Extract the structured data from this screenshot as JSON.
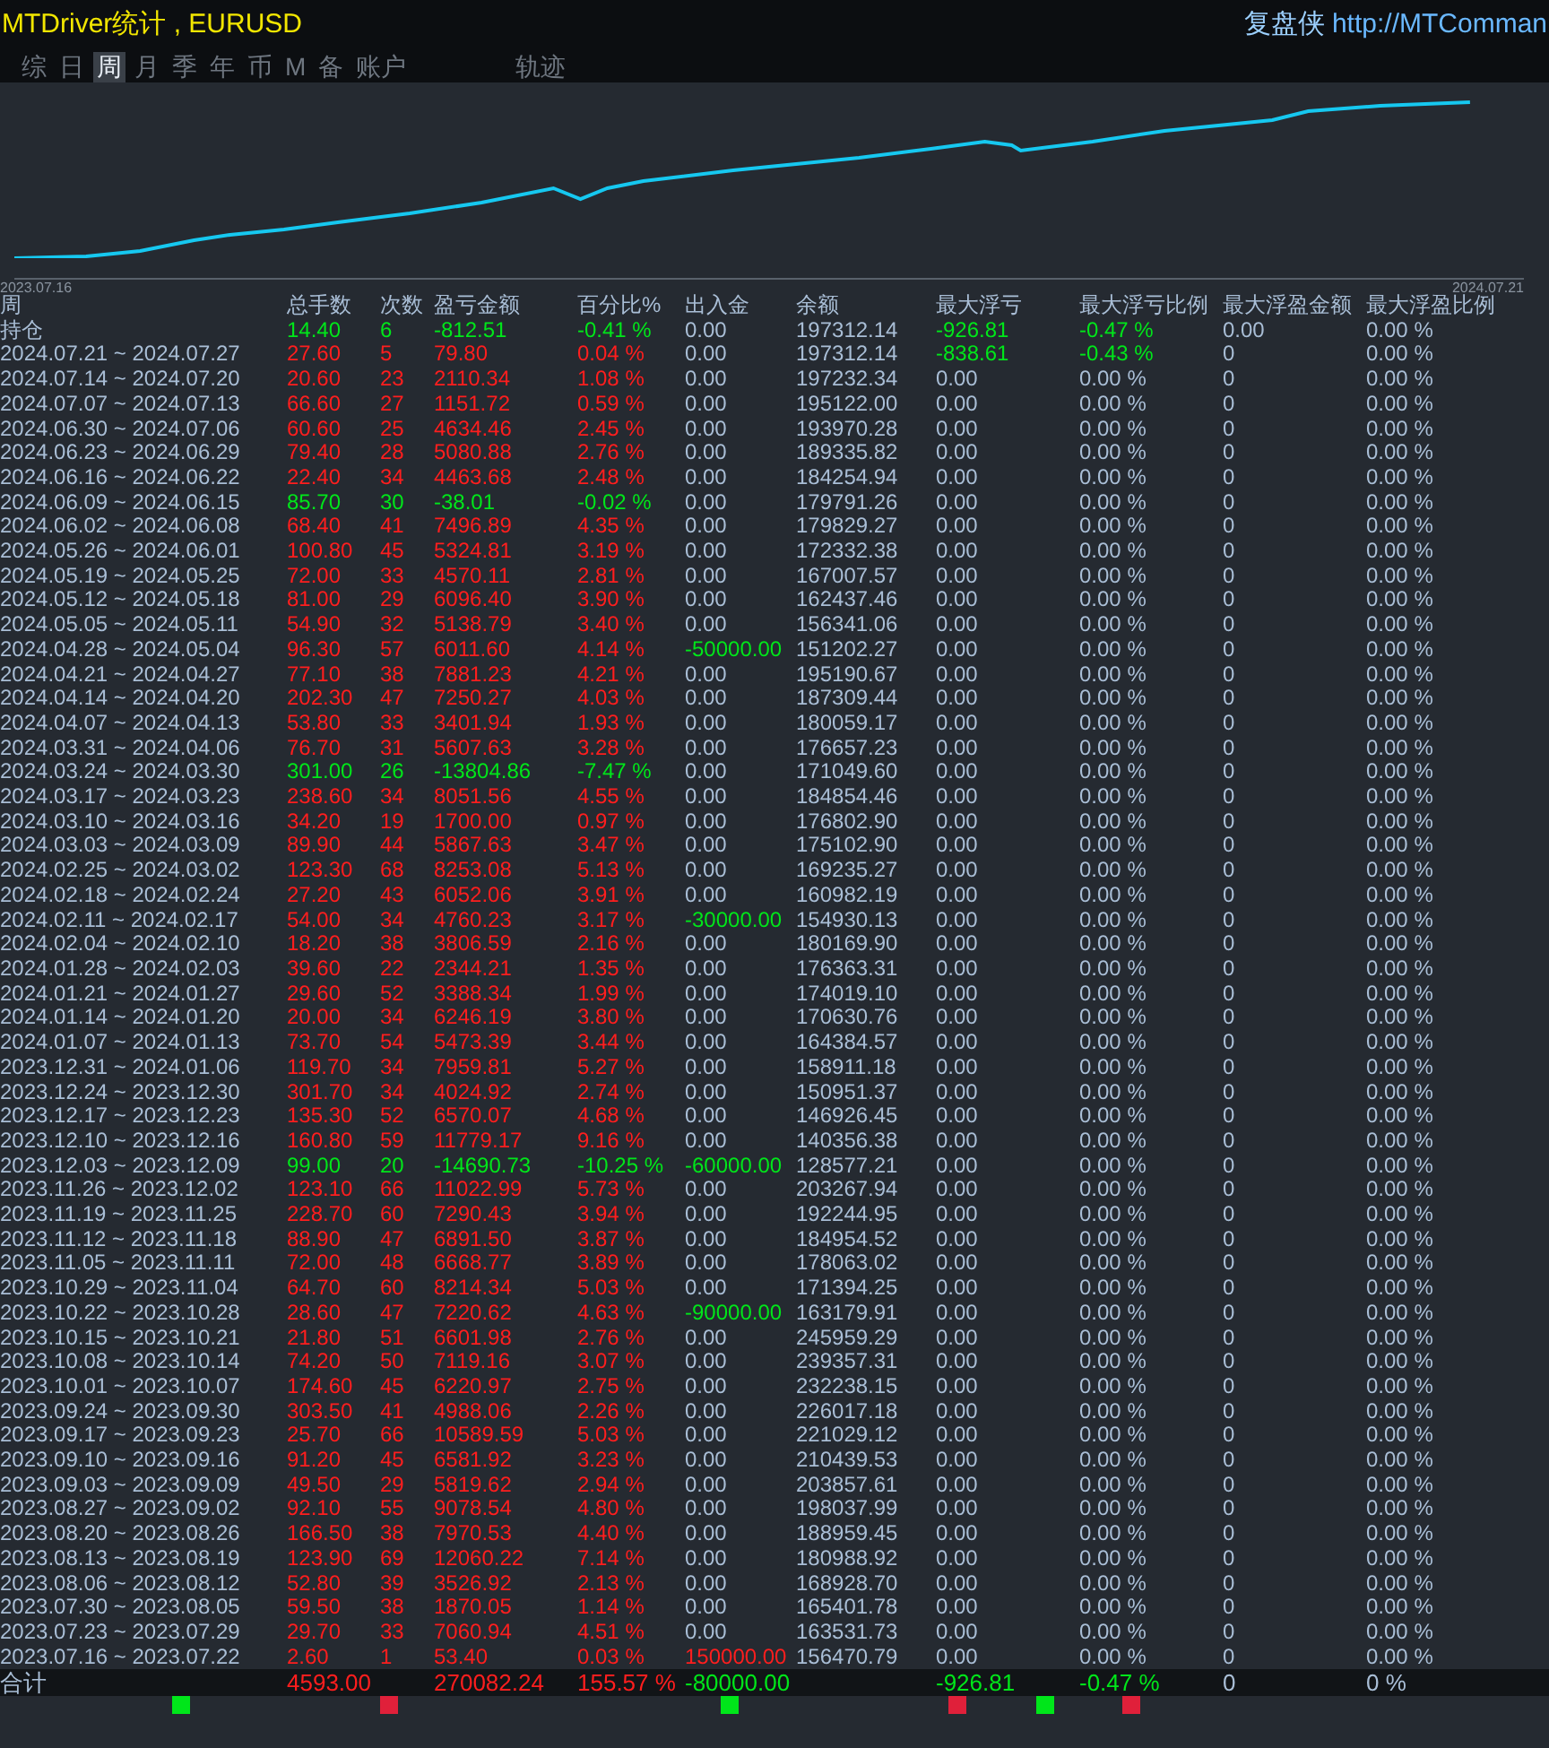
{
  "title": "MTDriver统计 , EURUSD",
  "brand": "复盘侠",
  "url": "http://MTComman",
  "tabs": [
    {
      "label": "综",
      "selected": false
    },
    {
      "label": "日",
      "selected": false
    },
    {
      "label": "周",
      "selected": true
    },
    {
      "label": "月",
      "selected": false
    },
    {
      "label": "季",
      "selected": false
    },
    {
      "label": "年",
      "selected": false
    },
    {
      "label": "币",
      "selected": false
    },
    {
      "label": "M",
      "selected": false
    },
    {
      "label": "备",
      "selected": false
    },
    {
      "label": "账户",
      "selected": false
    },
    {
      "label": "轨迹",
      "selected": false
    }
  ],
  "chart": {
    "start": "2023.07.16",
    "end": "2024.07.21"
  },
  "columns": [
    "周",
    "总手数",
    "次数",
    "盈亏金额",
    "百分比%",
    "出入金",
    "余额",
    "最大浮亏",
    "最大浮亏比例",
    "最大浮盈金额",
    "最大浮盈比例"
  ],
  "rows": [
    {
      "period": "持仓",
      "lots": "14.40",
      "trades": "6",
      "pnl": "-812.51",
      "pct": "-0.41 %",
      "flow_amount": "0.00",
      "balance": "197312.14",
      "max_loss": "-926.81",
      "max_loss_pct": "-0.47 %",
      "max_gain": "0.00",
      "max_gain_pct": "0.00 %",
      "profit": false,
      "inflow": false,
      "outflow": false,
      "loss_open": true
    },
    {
      "period": "2024.07.21 ~ 2024.07.27",
      "lots": "27.60",
      "trades": "5",
      "pnl": "79.80",
      "pct": "0.04 %",
      "flow_amount": "0.00",
      "balance": "197312.14",
      "max_loss": "-838.61",
      "max_loss_pct": "-0.43 %",
      "max_gain": "0",
      "max_gain_pct": "0.00 %",
      "profit": true,
      "inflow": false,
      "outflow": false,
      "loss_open": true
    },
    {
      "period": "2024.07.14 ~ 2024.07.20",
      "lots": "20.60",
      "trades": "23",
      "pnl": "2110.34",
      "pct": "1.08 %",
      "flow_amount": "0.00",
      "balance": "197232.34",
      "max_loss": "0.00",
      "max_loss_pct": "0.00 %",
      "max_gain": "0",
      "max_gain_pct": "0.00 %",
      "profit": true,
      "inflow": false,
      "outflow": false,
      "loss_open": false
    },
    {
      "period": "2024.07.07 ~ 2024.07.13",
      "lots": "66.60",
      "trades": "27",
      "pnl": "1151.72",
      "pct": "0.59 %",
      "flow_amount": "0.00",
      "balance": "195122.00",
      "max_loss": "0.00",
      "max_loss_pct": "0.00 %",
      "max_gain": "0",
      "max_gain_pct": "0.00 %",
      "profit": true,
      "inflow": false,
      "outflow": false,
      "loss_open": false
    },
    {
      "period": "2024.06.30 ~ 2024.07.06",
      "lots": "60.60",
      "trades": "25",
      "pnl": "4634.46",
      "pct": "2.45 %",
      "flow_amount": "0.00",
      "balance": "193970.28",
      "max_loss": "0.00",
      "max_loss_pct": "0.00 %",
      "max_gain": "0",
      "max_gain_pct": "0.00 %",
      "profit": true,
      "inflow": false,
      "outflow": false,
      "loss_open": false
    },
    {
      "period": "2024.06.23 ~ 2024.06.29",
      "lots": "79.40",
      "trades": "28",
      "pnl": "5080.88",
      "pct": "2.76 %",
      "flow_amount": "0.00",
      "balance": "189335.82",
      "max_loss": "0.00",
      "max_loss_pct": "0.00 %",
      "max_gain": "0",
      "max_gain_pct": "0.00 %",
      "profit": true,
      "inflow": false,
      "outflow": false,
      "loss_open": false
    },
    {
      "period": "2024.06.16 ~ 2024.06.22",
      "lots": "22.40",
      "trades": "34",
      "pnl": "4463.68",
      "pct": "2.48 %",
      "flow_amount": "0.00",
      "balance": "184254.94",
      "max_loss": "0.00",
      "max_loss_pct": "0.00 %",
      "max_gain": "0",
      "max_gain_pct": "0.00 %",
      "profit": true,
      "inflow": false,
      "outflow": false,
      "loss_open": false
    },
    {
      "period": "2024.06.09 ~ 2024.06.15",
      "lots": "85.70",
      "trades": "30",
      "pnl": "-38.01",
      "pct": "-0.02 %",
      "flow_amount": "0.00",
      "balance": "179791.26",
      "max_loss": "0.00",
      "max_loss_pct": "0.00 %",
      "max_gain": "0",
      "max_gain_pct": "0.00 %",
      "profit": false,
      "inflow": false,
      "outflow": false,
      "loss_open": false
    },
    {
      "period": "2024.06.02 ~ 2024.06.08",
      "lots": "68.40",
      "trades": "41",
      "pnl": "7496.89",
      "pct": "4.35 %",
      "flow_amount": "0.00",
      "balance": "179829.27",
      "max_loss": "0.00",
      "max_loss_pct": "0.00 %",
      "max_gain": "0",
      "max_gain_pct": "0.00 %",
      "profit": true,
      "inflow": false,
      "outflow": false,
      "loss_open": false
    },
    {
      "period": "2024.05.26 ~ 2024.06.01",
      "lots": "100.80",
      "trades": "45",
      "pnl": "5324.81",
      "pct": "3.19 %",
      "flow_amount": "0.00",
      "balance": "172332.38",
      "max_loss": "0.00",
      "max_loss_pct": "0.00 %",
      "max_gain": "0",
      "max_gain_pct": "0.00 %",
      "profit": true,
      "inflow": false,
      "outflow": false,
      "loss_open": false
    },
    {
      "period": "2024.05.19 ~ 2024.05.25",
      "lots": "72.00",
      "trades": "33",
      "pnl": "4570.11",
      "pct": "2.81 %",
      "flow_amount": "0.00",
      "balance": "167007.57",
      "max_loss": "0.00",
      "max_loss_pct": "0.00 %",
      "max_gain": "0",
      "max_gain_pct": "0.00 %",
      "profit": true,
      "inflow": false,
      "outflow": false,
      "loss_open": false
    },
    {
      "period": "2024.05.12 ~ 2024.05.18",
      "lots": "81.00",
      "trades": "29",
      "pnl": "6096.40",
      "pct": "3.90 %",
      "flow_amount": "0.00",
      "balance": "162437.46",
      "max_loss": "0.00",
      "max_loss_pct": "0.00 %",
      "max_gain": "0",
      "max_gain_pct": "0.00 %",
      "profit": true,
      "inflow": false,
      "outflow": false,
      "loss_open": false
    },
    {
      "period": "2024.05.05 ~ 2024.05.11",
      "lots": "54.90",
      "trades": "32",
      "pnl": "5138.79",
      "pct": "3.40 %",
      "flow_amount": "0.00",
      "balance": "156341.06",
      "max_loss": "0.00",
      "max_loss_pct": "0.00 %",
      "max_gain": "0",
      "max_gain_pct": "0.00 %",
      "profit": true,
      "inflow": false,
      "outflow": false,
      "loss_open": false
    },
    {
      "period": "2024.04.28 ~ 2024.05.04",
      "lots": "96.30",
      "trades": "57",
      "pnl": "6011.60",
      "pct": "4.14 %",
      "flow_amount": "-50000.00",
      "balance": "151202.27",
      "max_loss": "0.00",
      "max_loss_pct": "0.00 %",
      "max_gain": "0",
      "max_gain_pct": "0.00 %",
      "profit": true,
      "inflow": false,
      "outflow": true,
      "loss_open": false
    },
    {
      "period": "2024.04.21 ~ 2024.04.27",
      "lots": "77.10",
      "trades": "38",
      "pnl": "7881.23",
      "pct": "4.21 %",
      "flow_amount": "0.00",
      "balance": "195190.67",
      "max_loss": "0.00",
      "max_loss_pct": "0.00 %",
      "max_gain": "0",
      "max_gain_pct": "0.00 %",
      "profit": true,
      "inflow": false,
      "outflow": false,
      "loss_open": false
    },
    {
      "period": "2024.04.14 ~ 2024.04.20",
      "lots": "202.30",
      "trades": "47",
      "pnl": "7250.27",
      "pct": "4.03 %",
      "flow_amount": "0.00",
      "balance": "187309.44",
      "max_loss": "0.00",
      "max_loss_pct": "0.00 %",
      "max_gain": "0",
      "max_gain_pct": "0.00 %",
      "profit": true,
      "inflow": false,
      "outflow": false,
      "loss_open": false
    },
    {
      "period": "2024.04.07 ~ 2024.04.13",
      "lots": "53.80",
      "trades": "33",
      "pnl": "3401.94",
      "pct": "1.93 %",
      "flow_amount": "0.00",
      "balance": "180059.17",
      "max_loss": "0.00",
      "max_loss_pct": "0.00 %",
      "max_gain": "0",
      "max_gain_pct": "0.00 %",
      "profit": true,
      "inflow": false,
      "outflow": false,
      "loss_open": false
    },
    {
      "period": "2024.03.31 ~ 2024.04.06",
      "lots": "76.70",
      "trades": "31",
      "pnl": "5607.63",
      "pct": "3.28 %",
      "flow_amount": "0.00",
      "balance": "176657.23",
      "max_loss": "0.00",
      "max_loss_pct": "0.00 %",
      "max_gain": "0",
      "max_gain_pct": "0.00 %",
      "profit": true,
      "inflow": false,
      "outflow": false,
      "loss_open": false
    },
    {
      "period": "2024.03.24 ~ 2024.03.30",
      "lots": "301.00",
      "trades": "26",
      "pnl": "-13804.86",
      "pct": "-7.47 %",
      "flow_amount": "0.00",
      "balance": "171049.60",
      "max_loss": "0.00",
      "max_loss_pct": "0.00 %",
      "max_gain": "0",
      "max_gain_pct": "0.00 %",
      "profit": false,
      "inflow": false,
      "outflow": false,
      "loss_open": false
    },
    {
      "period": "2024.03.17 ~ 2024.03.23",
      "lots": "238.60",
      "trades": "34",
      "pnl": "8051.56",
      "pct": "4.55 %",
      "flow_amount": "0.00",
      "balance": "184854.46",
      "max_loss": "0.00",
      "max_loss_pct": "0.00 %",
      "max_gain": "0",
      "max_gain_pct": "0.00 %",
      "profit": true,
      "inflow": false,
      "outflow": false,
      "loss_open": false
    },
    {
      "period": "2024.03.10 ~ 2024.03.16",
      "lots": "34.20",
      "trades": "19",
      "pnl": "1700.00",
      "pct": "0.97 %",
      "flow_amount": "0.00",
      "balance": "176802.90",
      "max_loss": "0.00",
      "max_loss_pct": "0.00 %",
      "max_gain": "0",
      "max_gain_pct": "0.00 %",
      "profit": true,
      "inflow": false,
      "outflow": false,
      "loss_open": false
    },
    {
      "period": "2024.03.03 ~ 2024.03.09",
      "lots": "89.90",
      "trades": "44",
      "pnl": "5867.63",
      "pct": "3.47 %",
      "flow_amount": "0.00",
      "balance": "175102.90",
      "max_loss": "0.00",
      "max_loss_pct": "0.00 %",
      "max_gain": "0",
      "max_gain_pct": "0.00 %",
      "profit": true,
      "inflow": false,
      "outflow": false,
      "loss_open": false
    },
    {
      "period": "2024.02.25 ~ 2024.03.02",
      "lots": "123.30",
      "trades": "68",
      "pnl": "8253.08",
      "pct": "5.13 %",
      "flow_amount": "0.00",
      "balance": "169235.27",
      "max_loss": "0.00",
      "max_loss_pct": "0.00 %",
      "max_gain": "0",
      "max_gain_pct": "0.00 %",
      "profit": true,
      "inflow": false,
      "outflow": false,
      "loss_open": false
    },
    {
      "period": "2024.02.18 ~ 2024.02.24",
      "lots": "27.20",
      "trades": "43",
      "pnl": "6052.06",
      "pct": "3.91 %",
      "flow_amount": "0.00",
      "balance": "160982.19",
      "max_loss": "0.00",
      "max_loss_pct": "0.00 %",
      "max_gain": "0",
      "max_gain_pct": "0.00 %",
      "profit": true,
      "inflow": false,
      "outflow": false,
      "loss_open": false
    },
    {
      "period": "2024.02.11 ~ 2024.02.17",
      "lots": "54.00",
      "trades": "34",
      "pnl": "4760.23",
      "pct": "3.17 %",
      "flow_amount": "-30000.00",
      "balance": "154930.13",
      "max_loss": "0.00",
      "max_loss_pct": "0.00 %",
      "max_gain": "0",
      "max_gain_pct": "0.00 %",
      "profit": true,
      "inflow": false,
      "outflow": true,
      "loss_open": false
    },
    {
      "period": "2024.02.04 ~ 2024.02.10",
      "lots": "18.20",
      "trades": "38",
      "pnl": "3806.59",
      "pct": "2.16 %",
      "flow_amount": "0.00",
      "balance": "180169.90",
      "max_loss": "0.00",
      "max_loss_pct": "0.00 %",
      "max_gain": "0",
      "max_gain_pct": "0.00 %",
      "profit": true,
      "inflow": false,
      "outflow": false,
      "loss_open": false
    },
    {
      "period": "2024.01.28 ~ 2024.02.03",
      "lots": "39.60",
      "trades": "22",
      "pnl": "2344.21",
      "pct": "1.35 %",
      "flow_amount": "0.00",
      "balance": "176363.31",
      "max_loss": "0.00",
      "max_loss_pct": "0.00 %",
      "max_gain": "0",
      "max_gain_pct": "0.00 %",
      "profit": true,
      "inflow": false,
      "outflow": false,
      "loss_open": false
    },
    {
      "period": "2024.01.21 ~ 2024.01.27",
      "lots": "29.60",
      "trades": "52",
      "pnl": "3388.34",
      "pct": "1.99 %",
      "flow_amount": "0.00",
      "balance": "174019.10",
      "max_loss": "0.00",
      "max_loss_pct": "0.00 %",
      "max_gain": "0",
      "max_gain_pct": "0.00 %",
      "profit": true,
      "inflow": false,
      "outflow": false,
      "loss_open": false
    },
    {
      "period": "2024.01.14 ~ 2024.01.20",
      "lots": "20.00",
      "trades": "34",
      "pnl": "6246.19",
      "pct": "3.80 %",
      "flow_amount": "0.00",
      "balance": "170630.76",
      "max_loss": "0.00",
      "max_loss_pct": "0.00 %",
      "max_gain": "0",
      "max_gain_pct": "0.00 %",
      "profit": true,
      "inflow": false,
      "outflow": false,
      "loss_open": false
    },
    {
      "period": "2024.01.07 ~ 2024.01.13",
      "lots": "73.70",
      "trades": "54",
      "pnl": "5473.39",
      "pct": "3.44 %",
      "flow_amount": "0.00",
      "balance": "164384.57",
      "max_loss": "0.00",
      "max_loss_pct": "0.00 %",
      "max_gain": "0",
      "max_gain_pct": "0.00 %",
      "profit": true,
      "inflow": false,
      "outflow": false,
      "loss_open": false
    },
    {
      "period": "2023.12.31 ~ 2024.01.06",
      "lots": "119.70",
      "trades": "34",
      "pnl": "7959.81",
      "pct": "5.27 %",
      "flow_amount": "0.00",
      "balance": "158911.18",
      "max_loss": "0.00",
      "max_loss_pct": "0.00 %",
      "max_gain": "0",
      "max_gain_pct": "0.00 %",
      "profit": true,
      "inflow": false,
      "outflow": false,
      "loss_open": false
    },
    {
      "period": "2023.12.24 ~ 2023.12.30",
      "lots": "301.70",
      "trades": "34",
      "pnl": "4024.92",
      "pct": "2.74 %",
      "flow_amount": "0.00",
      "balance": "150951.37",
      "max_loss": "0.00",
      "max_loss_pct": "0.00 %",
      "max_gain": "0",
      "max_gain_pct": "0.00 %",
      "profit": true,
      "inflow": false,
      "outflow": false,
      "loss_open": false
    },
    {
      "period": "2023.12.17 ~ 2023.12.23",
      "lots": "135.30",
      "trades": "52",
      "pnl": "6570.07",
      "pct": "4.68 %",
      "flow_amount": "0.00",
      "balance": "146926.45",
      "max_loss": "0.00",
      "max_loss_pct": "0.00 %",
      "max_gain": "0",
      "max_gain_pct": "0.00 %",
      "profit": true,
      "inflow": false,
      "outflow": false,
      "loss_open": false
    },
    {
      "period": "2023.12.10 ~ 2023.12.16",
      "lots": "160.80",
      "trades": "59",
      "pnl": "11779.17",
      "pct": "9.16 %",
      "flow_amount": "0.00",
      "balance": "140356.38",
      "max_loss": "0.00",
      "max_loss_pct": "0.00 %",
      "max_gain": "0",
      "max_gain_pct": "0.00 %",
      "profit": true,
      "inflow": false,
      "outflow": false,
      "loss_open": false
    },
    {
      "period": "2023.12.03 ~ 2023.12.09",
      "lots": "99.00",
      "trades": "20",
      "pnl": "-14690.73",
      "pct": "-10.25 %",
      "flow_amount": "-60000.00",
      "balance": "128577.21",
      "max_loss": "0.00",
      "max_loss_pct": "0.00 %",
      "max_gain": "0",
      "max_gain_pct": "0.00 %",
      "profit": false,
      "inflow": false,
      "outflow": true,
      "loss_open": false
    },
    {
      "period": "2023.11.26 ~ 2023.12.02",
      "lots": "123.10",
      "trades": "66",
      "pnl": "11022.99",
      "pct": "5.73 %",
      "flow_amount": "0.00",
      "balance": "203267.94",
      "max_loss": "0.00",
      "max_loss_pct": "0.00 %",
      "max_gain": "0",
      "max_gain_pct": "0.00 %",
      "profit": true,
      "inflow": false,
      "outflow": false,
      "loss_open": false
    },
    {
      "period": "2023.11.19 ~ 2023.11.25",
      "lots": "228.70",
      "trades": "60",
      "pnl": "7290.43",
      "pct": "3.94 %",
      "flow_amount": "0.00",
      "balance": "192244.95",
      "max_loss": "0.00",
      "max_loss_pct": "0.00 %",
      "max_gain": "0",
      "max_gain_pct": "0.00 %",
      "profit": true,
      "inflow": false,
      "outflow": false,
      "loss_open": false
    },
    {
      "period": "2023.11.12 ~ 2023.11.18",
      "lots": "88.90",
      "trades": "47",
      "pnl": "6891.50",
      "pct": "3.87 %",
      "flow_amount": "0.00",
      "balance": "184954.52",
      "max_loss": "0.00",
      "max_loss_pct": "0.00 %",
      "max_gain": "0",
      "max_gain_pct": "0.00 %",
      "profit": true,
      "inflow": false,
      "outflow": false,
      "loss_open": false
    },
    {
      "period": "2023.11.05 ~ 2023.11.11",
      "lots": "72.00",
      "trades": "48",
      "pnl": "6668.77",
      "pct": "3.89 %",
      "flow_amount": "0.00",
      "balance": "178063.02",
      "max_loss": "0.00",
      "max_loss_pct": "0.00 %",
      "max_gain": "0",
      "max_gain_pct": "0.00 %",
      "profit": true,
      "inflow": false,
      "outflow": false,
      "loss_open": false
    },
    {
      "period": "2023.10.29 ~ 2023.11.04",
      "lots": "64.70",
      "trades": "60",
      "pnl": "8214.34",
      "pct": "5.03 %",
      "flow_amount": "0.00",
      "balance": "171394.25",
      "max_loss": "0.00",
      "max_loss_pct": "0.00 %",
      "max_gain": "0",
      "max_gain_pct": "0.00 %",
      "profit": true,
      "inflow": false,
      "outflow": false,
      "loss_open": false
    },
    {
      "period": "2023.10.22 ~ 2023.10.28",
      "lots": "28.60",
      "trades": "47",
      "pnl": "7220.62",
      "pct": "4.63 %",
      "flow_amount": "-90000.00",
      "balance": "163179.91",
      "max_loss": "0.00",
      "max_loss_pct": "0.00 %",
      "max_gain": "0",
      "max_gain_pct": "0.00 %",
      "profit": true,
      "inflow": false,
      "outflow": true,
      "loss_open": false
    },
    {
      "period": "2023.10.15 ~ 2023.10.21",
      "lots": "21.80",
      "trades": "51",
      "pnl": "6601.98",
      "pct": "2.76 %",
      "flow_amount": "0.00",
      "balance": "245959.29",
      "max_loss": "0.00",
      "max_loss_pct": "0.00 %",
      "max_gain": "0",
      "max_gain_pct": "0.00 %",
      "profit": true,
      "inflow": false,
      "outflow": false,
      "loss_open": false
    },
    {
      "period": "2023.10.08 ~ 2023.10.14",
      "lots": "74.20",
      "trades": "50",
      "pnl": "7119.16",
      "pct": "3.07 %",
      "flow_amount": "0.00",
      "balance": "239357.31",
      "max_loss": "0.00",
      "max_loss_pct": "0.00 %",
      "max_gain": "0",
      "max_gain_pct": "0.00 %",
      "profit": true,
      "inflow": false,
      "outflow": false,
      "loss_open": false
    },
    {
      "period": "2023.10.01 ~ 2023.10.07",
      "lots": "174.60",
      "trades": "45",
      "pnl": "6220.97",
      "pct": "2.75 %",
      "flow_amount": "0.00",
      "balance": "232238.15",
      "max_loss": "0.00",
      "max_loss_pct": "0.00 %",
      "max_gain": "0",
      "max_gain_pct": "0.00 %",
      "profit": true,
      "inflow": false,
      "outflow": false,
      "loss_open": false
    },
    {
      "period": "2023.09.24 ~ 2023.09.30",
      "lots": "303.50",
      "trades": "41",
      "pnl": "4988.06",
      "pct": "2.26 %",
      "flow_amount": "0.00",
      "balance": "226017.18",
      "max_loss": "0.00",
      "max_loss_pct": "0.00 %",
      "max_gain": "0",
      "max_gain_pct": "0.00 %",
      "profit": true,
      "inflow": false,
      "outflow": false,
      "loss_open": false
    },
    {
      "period": "2023.09.17 ~ 2023.09.23",
      "lots": "25.70",
      "trades": "66",
      "pnl": "10589.59",
      "pct": "5.03 %",
      "flow_amount": "0.00",
      "balance": "221029.12",
      "max_loss": "0.00",
      "max_loss_pct": "0.00 %",
      "max_gain": "0",
      "max_gain_pct": "0.00 %",
      "profit": true,
      "inflow": false,
      "outflow": false,
      "loss_open": false
    },
    {
      "period": "2023.09.10 ~ 2023.09.16",
      "lots": "91.20",
      "trades": "45",
      "pnl": "6581.92",
      "pct": "3.23 %",
      "flow_amount": "0.00",
      "balance": "210439.53",
      "max_loss": "0.00",
      "max_loss_pct": "0.00 %",
      "max_gain": "0",
      "max_gain_pct": "0.00 %",
      "profit": true,
      "inflow": false,
      "outflow": false,
      "loss_open": false
    },
    {
      "period": "2023.09.03 ~ 2023.09.09",
      "lots": "49.50",
      "trades": "29",
      "pnl": "5819.62",
      "pct": "2.94 %",
      "flow_amount": "0.00",
      "balance": "203857.61",
      "max_loss": "0.00",
      "max_loss_pct": "0.00 %",
      "max_gain": "0",
      "max_gain_pct": "0.00 %",
      "profit": true,
      "inflow": false,
      "outflow": false,
      "loss_open": false
    },
    {
      "period": "2023.08.27 ~ 2023.09.02",
      "lots": "92.10",
      "trades": "55",
      "pnl": "9078.54",
      "pct": "4.80 %",
      "flow_amount": "0.00",
      "balance": "198037.99",
      "max_loss": "0.00",
      "max_loss_pct": "0.00 %",
      "max_gain": "0",
      "max_gain_pct": "0.00 %",
      "profit": true,
      "inflow": false,
      "outflow": false,
      "loss_open": false
    },
    {
      "period": "2023.08.20 ~ 2023.08.26",
      "lots": "166.50",
      "trades": "38",
      "pnl": "7970.53",
      "pct": "4.40 %",
      "flow_amount": "0.00",
      "balance": "188959.45",
      "max_loss": "0.00",
      "max_loss_pct": "0.00 %",
      "max_gain": "0",
      "max_gain_pct": "0.00 %",
      "profit": true,
      "inflow": false,
      "outflow": false,
      "loss_open": false
    },
    {
      "period": "2023.08.13 ~ 2023.08.19",
      "lots": "123.90",
      "trades": "69",
      "pnl": "12060.22",
      "pct": "7.14 %",
      "flow_amount": "0.00",
      "balance": "180988.92",
      "max_loss": "0.00",
      "max_loss_pct": "0.00 %",
      "max_gain": "0",
      "max_gain_pct": "0.00 %",
      "profit": true,
      "inflow": false,
      "outflow": false,
      "loss_open": false
    },
    {
      "period": "2023.08.06 ~ 2023.08.12",
      "lots": "52.80",
      "trades": "39",
      "pnl": "3526.92",
      "pct": "2.13 %",
      "flow_amount": "0.00",
      "balance": "168928.70",
      "max_loss": "0.00",
      "max_loss_pct": "0.00 %",
      "max_gain": "0",
      "max_gain_pct": "0.00 %",
      "profit": true,
      "inflow": false,
      "outflow": false,
      "loss_open": false
    },
    {
      "period": "2023.07.30 ~ 2023.08.05",
      "lots": "59.50",
      "trades": "38",
      "pnl": "1870.05",
      "pct": "1.14 %",
      "flow_amount": "0.00",
      "balance": "165401.78",
      "max_loss": "0.00",
      "max_loss_pct": "0.00 %",
      "max_gain": "0",
      "max_gain_pct": "0.00 %",
      "profit": true,
      "inflow": false,
      "outflow": false,
      "loss_open": false
    },
    {
      "period": "2023.07.23 ~ 2023.07.29",
      "lots": "29.70",
      "trades": "33",
      "pnl": "7060.94",
      "pct": "4.51 %",
      "flow_amount": "0.00",
      "balance": "163531.73",
      "max_loss": "0.00",
      "max_loss_pct": "0.00 %",
      "max_gain": "0",
      "max_gain_pct": "0.00 %",
      "profit": true,
      "inflow": false,
      "outflow": false,
      "loss_open": false
    },
    {
      "period": "2023.07.16 ~ 2023.07.22",
      "lots": "2.60",
      "trades": "1",
      "pnl": "53.40",
      "pct": "0.03 %",
      "flow_amount": "150000.00",
      "balance": "156470.79",
      "max_loss": "0.00",
      "max_loss_pct": "0.00 %",
      "max_gain": "0",
      "max_gain_pct": "0.00 %",
      "profit": true,
      "inflow": true,
      "outflow": false,
      "loss_open": false
    }
  ],
  "totals": {
    "label": "合计",
    "lots": "4593.00",
    "pnl": "270082.24",
    "pct": "155.57 %",
    "flow_amount": "-80000.00",
    "max_loss": "-926.81",
    "max_loss_pct": "-0.47 %",
    "max_gain": "0",
    "max_gain_pct": "0 %"
  }
}
